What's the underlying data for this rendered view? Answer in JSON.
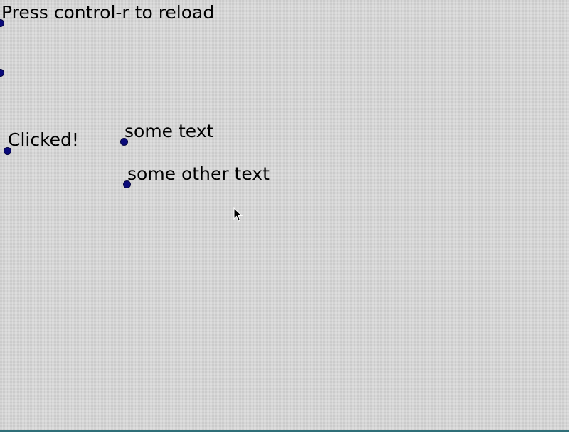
{
  "header": {
    "reload_hint": "Press control-r to reload"
  },
  "widgets": {
    "clicked_label": "Clicked!",
    "text_1": "some text",
    "text_2": "some other text"
  },
  "icons": {
    "handle": "circle-handle-icon",
    "cursor": "arrow-cursor-icon"
  },
  "colors": {
    "background": "#d6d6d6",
    "handle": "#0a0a7a",
    "text": "#000000",
    "bottom_bar": "#2f6f78"
  }
}
